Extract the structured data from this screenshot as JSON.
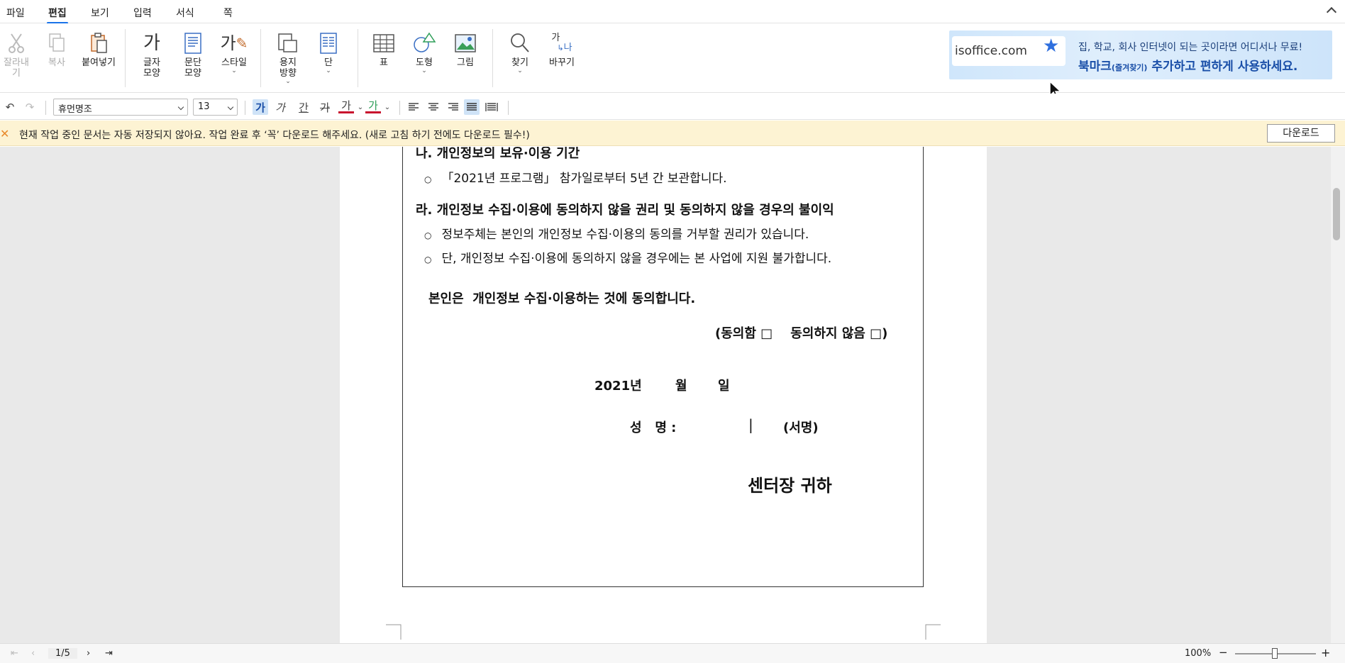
{
  "menubar": {
    "items": [
      "파일",
      "편집",
      "보기",
      "입력",
      "서식",
      "쪽"
    ],
    "active": "편집"
  },
  "ribbon": {
    "cut": "잘라내기",
    "copy": "복사",
    "paste": "붙여넣기",
    "char_shape": "글자\n모양",
    "char_shape_l1": "글자",
    "char_shape_l2": "모양",
    "para_l1": "문단",
    "para_l2": "모양",
    "style": "스타일",
    "paper_l1": "용지",
    "paper_l2": "방향",
    "column": "단",
    "table": "표",
    "shape": "도형",
    "image": "그림",
    "find": "찾기",
    "replace": "바꾸기",
    "char_icon_text": "가",
    "style_icon_text": "가",
    "replace_icon_top": "가",
    "replace_icon_bottom": "나"
  },
  "ad": {
    "url": "isoffice.com",
    "line1": "집, 학교, 회사 인터넷이 되는 곳이라면 어디서나 무료!",
    "line2_a": "북마크",
    "line2_b": "(즐겨찾기)",
    "line2_c": " 추가하고 편하게 사용하세요."
  },
  "formatbar": {
    "font_name": "휴먼명조",
    "font_size": "13",
    "bold": "가",
    "italic": "가",
    "underline": "간",
    "strike": "가",
    "font_color": "가",
    "highlight": "가"
  },
  "notice": {
    "text": "현재 작업 중인 문서는 자동 저장되지 않아요. 작업 완료 후 ‘꼭’ 다운로드 해주세요. (새로 고침 하기 전에도 다운로드 필수!)",
    "button": "다운로드"
  },
  "document": {
    "heading_na": "나. 개인정보의 보유·이용 기간",
    "bullet_na1": "「2021년 프로그램」 참가일로부터 5년 간 보관합니다.",
    "heading_ra": "라. 개인정보 수집·이용에 동의하지 않을 권리 및 동의하지 않을 경우의 불이익",
    "bullet_ra1": "정보주체는 본인의 개인정보 수집·이용의 동의를 거부할 권리가 있습니다.",
    "bullet_ra2": "단, 개인정보 수집·이용에 동의하지 않을 경우에는 본 사업에 지원 불가합니다.",
    "consent_statement": "본인은  개인정보 수집·이용하는 것에 동의합니다.",
    "consent_options": "(동의함 □    동의하지 않음 □)",
    "date_year": "2021년",
    "date_month": "월",
    "date_day": "일",
    "name_label": "성   명 :",
    "cursor": "|",
    "sign_label": "(서명)",
    "addressee": "센터장 귀하"
  },
  "statusbar": {
    "page_indicator": "1/5",
    "zoom": "100%",
    "zoom_out": "−",
    "zoom_in": "+"
  }
}
